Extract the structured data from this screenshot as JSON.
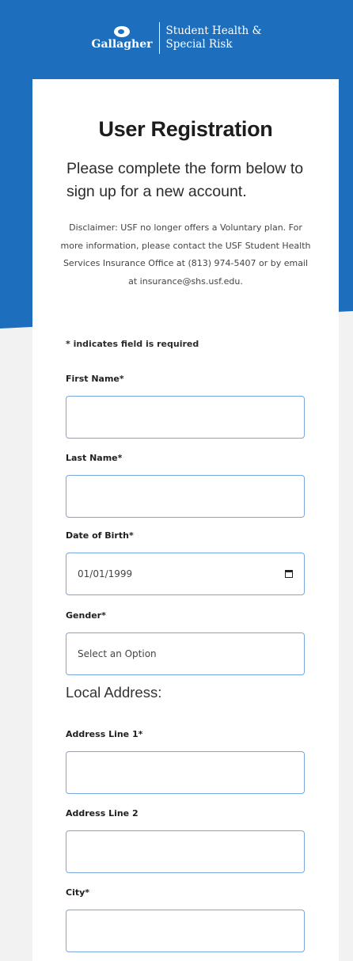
{
  "brand": {
    "name": "Gallagher",
    "tagline_line1": "Student Health &",
    "tagline_line2": "Special Risk"
  },
  "page": {
    "title": "User Registration",
    "intro": "Please complete the form below to sign up for a new account.",
    "disclaimer": "Disclaimer: USF no longer offers a Voluntary plan. For more information, please contact the USF Student Health Services Insurance Office at (813) 974-5407 or by email at insurance@shs.usf.edu."
  },
  "form": {
    "required_note": "* indicates field is required",
    "first_name": {
      "label": "First Name*",
      "value": ""
    },
    "last_name": {
      "label": "Last Name*",
      "value": ""
    },
    "dob": {
      "label": "Date of Birth*",
      "value": "01/01/1999"
    },
    "gender": {
      "label": "Gender*",
      "value": "Select an Option"
    },
    "local_address_heading": "Local Address:",
    "address1": {
      "label": "Address Line 1*",
      "value": ""
    },
    "address2": {
      "label": "Address Line 2",
      "value": ""
    },
    "city": {
      "label": "City*",
      "value": ""
    }
  },
  "colors": {
    "brand_blue": "#1d6fbd",
    "input_border": "#7aa8dd"
  }
}
